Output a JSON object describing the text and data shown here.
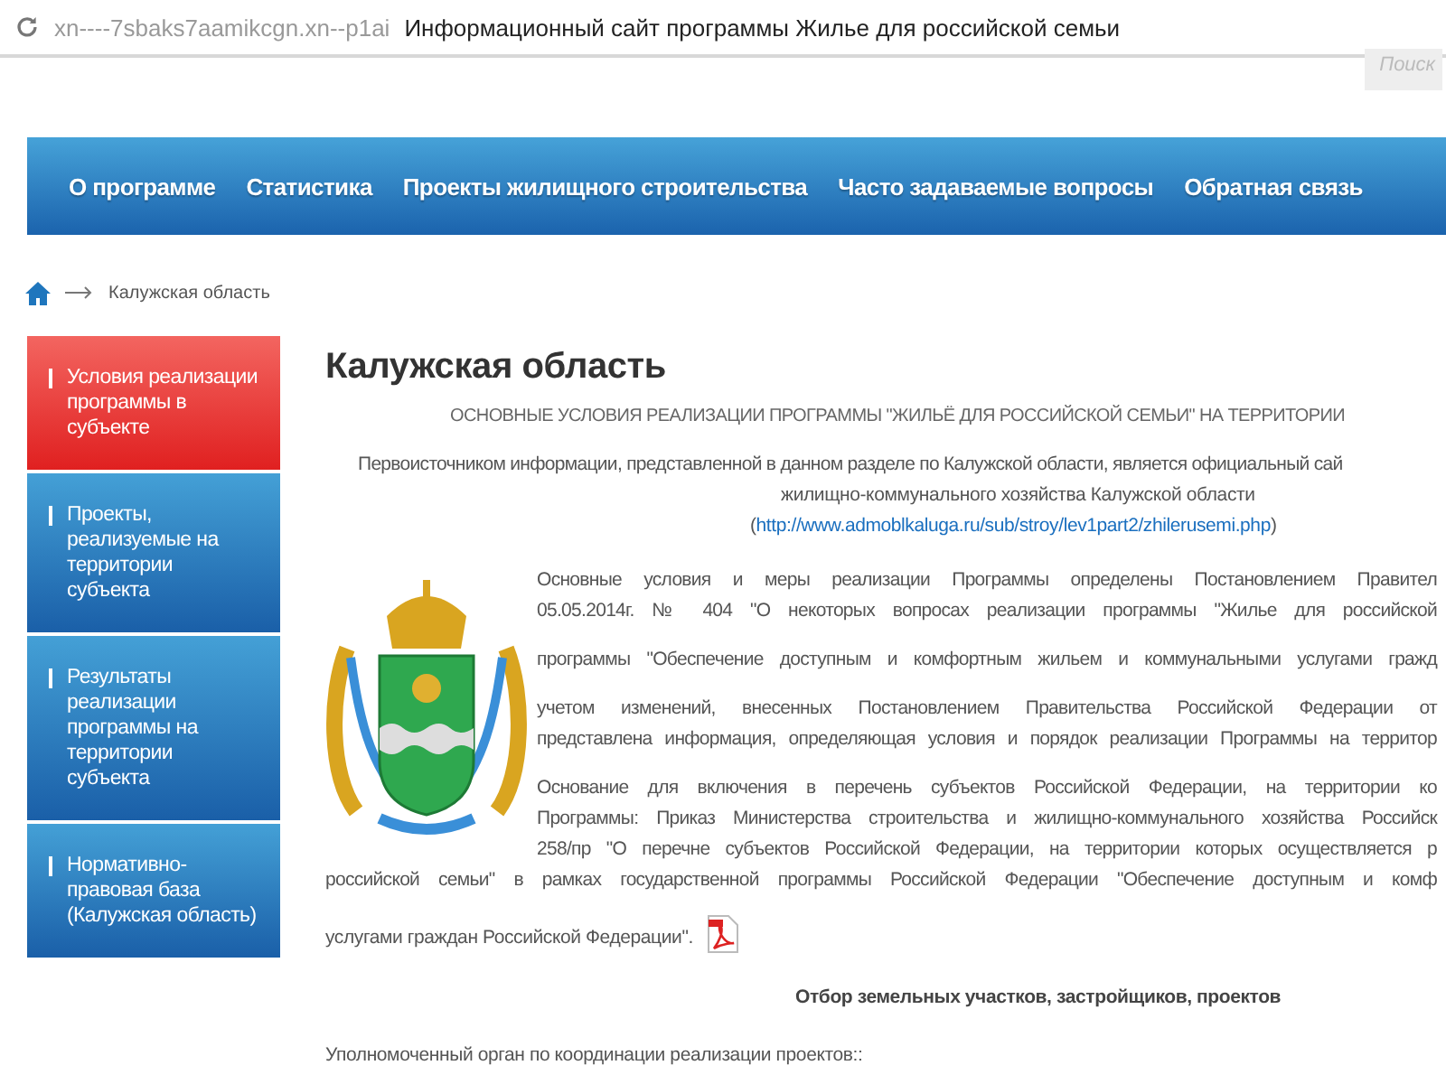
{
  "browser": {
    "url": "xn----7sbaks7aamikcgn.xn--p1ai",
    "title": "Информационный сайт программы Жилье для российской семьи"
  },
  "search": {
    "placeholder": "Поиск"
  },
  "nav": [
    {
      "label": "О программе"
    },
    {
      "label": "Статистика"
    },
    {
      "label": "Проекты жилищного строительства"
    },
    {
      "label": "Часто задаваемые вопросы"
    },
    {
      "label": "Обратная связь"
    }
  ],
  "breadcrumb": {
    "current": "Калужская область"
  },
  "sidebar": {
    "items": [
      {
        "label": "Условия реализации программы в субъекте",
        "selected": true
      },
      {
        "label": "Проекты, реализуемые на территории субъекта",
        "selected": false
      },
      {
        "label": "Результаты реализации программы на территории субъекта",
        "selected": false
      },
      {
        "label": "Нормативно-правовая база (Калужская область)",
        "selected": false
      }
    ]
  },
  "content": {
    "title": "Калужская область",
    "subtitle": "ОСНОВНЫЕ УСЛОВИЯ РЕАЛИЗАЦИИ ПРОГРАММЫ \"ЖИЛЬЁ ДЛЯ РОССИЙСКОЙ СЕМЬИ\" НА ТЕРРИТОРИИ",
    "source": {
      "lines": [
        "Первоисточником информации, представленной в данном разделе по Калужской области, является официальный сай",
        "жилищно-коммунального хозяйства Калужской области"
      ],
      "open_bracket": "(",
      "link": "http://www.admoblkaluga.ru/sub/stroy/lev1part2/zhilerusemi.php",
      "close_bracket": ")"
    },
    "paragraphs": [
      {
        "lines": [
          "Основные условия и меры реализации Программы определены Постановлением Правител",
          "05.05.2014г. № 404 \"О некоторых вопросах реализации программы \"Жилье для российской"
        ]
      },
      {
        "lines": [
          "программы \"Обеспечение доступным и комфортным жильем и коммунальными услугами гражд"
        ]
      },
      {
        "lines": [
          "учетом изменений, внесенных Постановлением Правительства Российской Федерации от",
          "представлена информация, определяющая условия и порядок реализации Программы на территор"
        ]
      },
      {
        "lines": [
          "Основание для включения в перечень субъектов Российской Федерации, на территории ко",
          "Программы: Приказ Министерства строительства и жилищно-коммунального хозяйства Российск",
          "258/пр \"О перечне субъектов Российской Федерации, на территории которых осуществляется р",
          "российской семьи\" в рамках государственной программы Российской Федерации \"Обеспечение доступным и комф"
        ]
      }
    ],
    "closing": "услугами граждан Российской Федерации\".",
    "section_heading": "Отбор земельных участков, застройщиков, проектов",
    "footer_line": "Уполномоченный орган по координации реализации проектов::"
  }
}
